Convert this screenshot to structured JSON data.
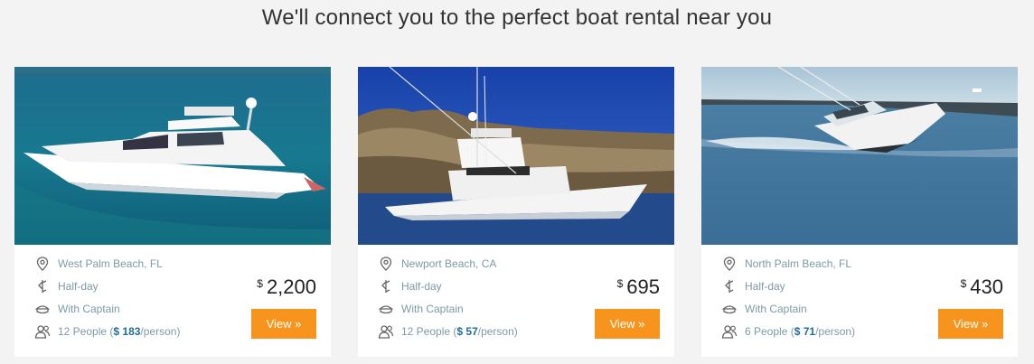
{
  "page": {
    "heading": "We'll connect you to the perfect boat rental near you"
  },
  "colors": {
    "accent": "#f7941d",
    "muted_text": "#7d9aa6",
    "per_person_price": "#1e6e98"
  },
  "listings": [
    {
      "location": "West Palm Beach, FL",
      "duration": "Half-day",
      "captain": "With Captain",
      "people": "12 People (",
      "per_person": "$ 183",
      "per_suffix": " /person)",
      "currency": "$",
      "price": "2,200",
      "button": "View »"
    },
    {
      "location": "Newport Beach, CA",
      "duration": "Half-day",
      "captain": "With Captain",
      "people": "12 People (",
      "per_person": "$ 57",
      "per_suffix": " /person)",
      "currency": "$",
      "price": "695",
      "button": "View »"
    },
    {
      "location": "North Palm Beach, FL",
      "duration": "Half-day",
      "captain": "With Captain",
      "people": "6 People (",
      "per_person": "$ 71",
      "per_suffix": " /person)",
      "currency": "$",
      "price": "430",
      "button": "View »"
    }
  ],
  "icons": [
    "map-pin-icon",
    "boat-duration-icon",
    "captain-hat-icon",
    "people-icon"
  ]
}
